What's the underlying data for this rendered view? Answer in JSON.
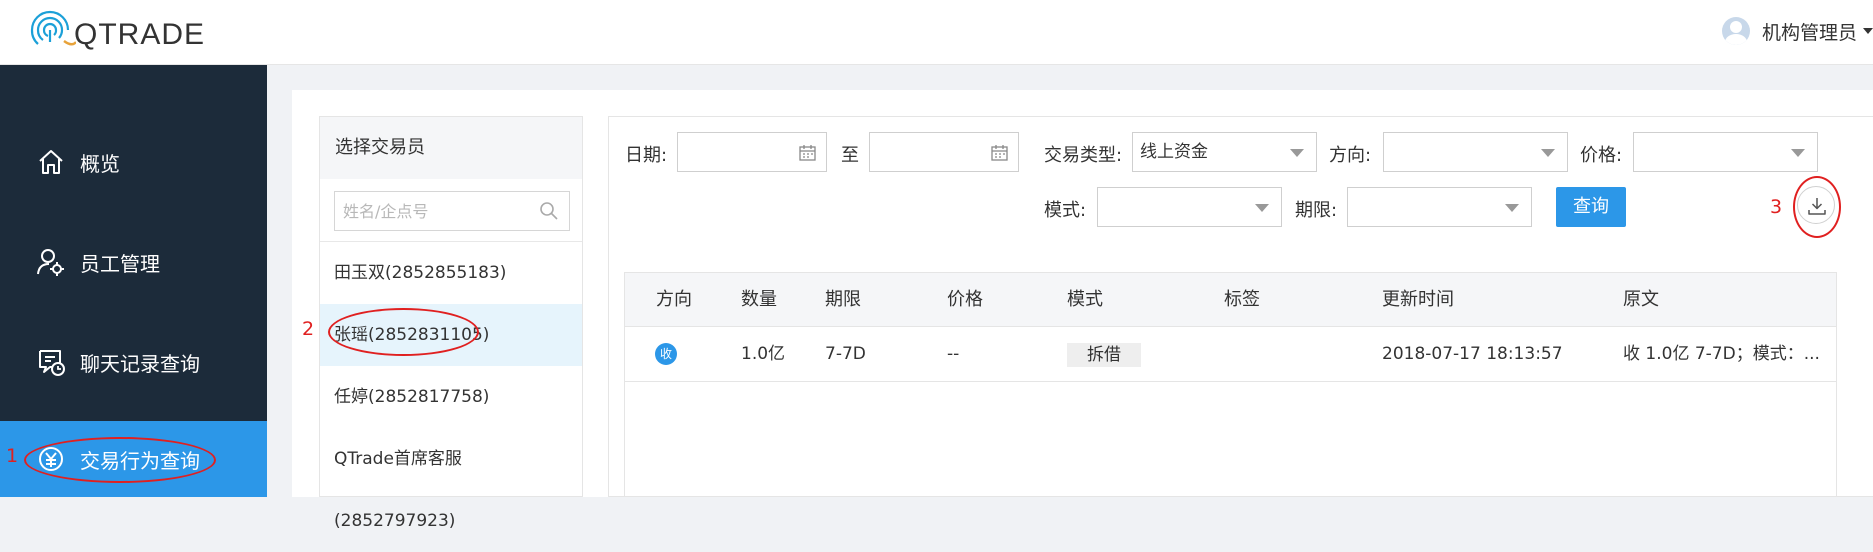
{
  "header": {
    "logo_text": "QTRADE",
    "user_name": "机构管理员"
  },
  "sidebar": {
    "items": [
      {
        "label": "概览",
        "icon": "home-icon"
      },
      {
        "label": "员工管理",
        "icon": "user-settings-icon"
      },
      {
        "label": "聊天记录查询",
        "icon": "chat-clock-icon"
      },
      {
        "label": "交易行为查询",
        "icon": "yuan-icon",
        "active": true
      }
    ]
  },
  "annotations": {
    "one": "1",
    "two": "2",
    "three": "3"
  },
  "trader_panel": {
    "title": "选择交易员",
    "search_placeholder": "姓名/企点号",
    "items": [
      {
        "label": "田玉双(2852855183)"
      },
      {
        "label": "张瑶(2852831105)",
        "selected": true
      },
      {
        "label": "任婷(2852817758)"
      },
      {
        "label": "QTrade首席客服(2852797923)"
      }
    ]
  },
  "filters": {
    "date_label": "日期:",
    "to_label": "至",
    "date_from": "",
    "date_to": "",
    "trade_type_label": "交易类型:",
    "trade_type_value": "线上资金",
    "direction_label": "方向:",
    "direction_value": "",
    "price_label": "价格:",
    "price_value": "",
    "mode_label": "模式:",
    "mode_value": "",
    "term_label": "期限:",
    "term_value": "",
    "query_button": "查询"
  },
  "table": {
    "columns": [
      "方向",
      "数量",
      "期限",
      "价格",
      "模式",
      "标签",
      "更新时间",
      "原文"
    ],
    "rows": [
      {
        "direction": "收",
        "amount": "1.0亿",
        "term": "7-7D",
        "price": "--",
        "mode": "拆借",
        "tag": "",
        "updated": "2018-07-17 18:13:57",
        "original": "收 1.0亿 7-7D；模式：..."
      }
    ]
  },
  "colors": {
    "sidebar_bg": "#1c2b3a",
    "accent": "#2c97e8",
    "annotation": "#e02020"
  }
}
